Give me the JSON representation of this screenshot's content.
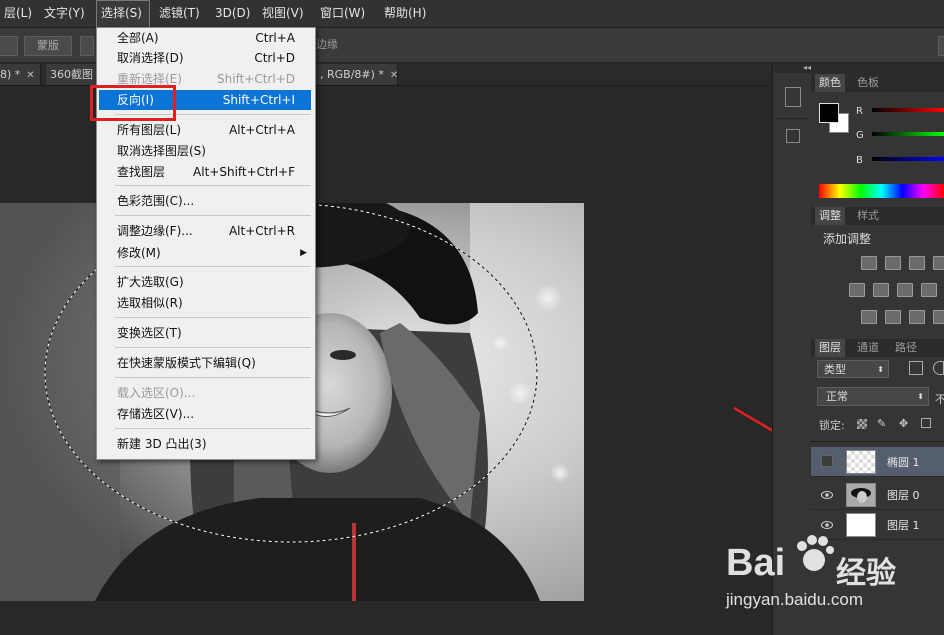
{
  "menubar": {
    "items": [
      "层(L)",
      "文字(Y)",
      "选择(S)",
      "滤镜(T)",
      "3D(D)",
      "视图(V)",
      "窗口(W)",
      "帮助(H)"
    ]
  },
  "optionsbar": {
    "btn_mask": "蒙版",
    "btn_edge": "边缘"
  },
  "tabs": [
    {
      "label": "8) *"
    },
    {
      "label": "360截图"
    },
    {
      "label": ", RGB/8#) *"
    }
  ],
  "select_menu": {
    "items": [
      {
        "label": "全部(A)",
        "shortcut": "Ctrl+A"
      },
      {
        "label": "取消选择(D)",
        "shortcut": "Ctrl+D"
      },
      {
        "label": "重新选择(E)",
        "shortcut": "Shift+Ctrl+D"
      },
      {
        "label": "反向(I)",
        "shortcut": "Shift+Ctrl+I"
      },
      {
        "label": "所有图层(L)",
        "shortcut": "Alt+Ctrl+A"
      },
      {
        "label": "取消选择图层(S)",
        "shortcut": ""
      },
      {
        "label": "查找图层",
        "shortcut": "Alt+Shift+Ctrl+F"
      },
      {
        "label": "色彩范围(C)...",
        "shortcut": ""
      },
      {
        "label": "调整边缘(F)...",
        "shortcut": "Alt+Ctrl+R"
      },
      {
        "label": "修改(M)",
        "shortcut": ""
      },
      {
        "label": "扩大选取(G)",
        "shortcut": ""
      },
      {
        "label": "选取相似(R)",
        "shortcut": ""
      },
      {
        "label": "变换选区(T)",
        "shortcut": ""
      },
      {
        "label": "在快速蒙版模式下编辑(Q)",
        "shortcut": ""
      },
      {
        "label": "载入选区(O)...",
        "shortcut": ""
      },
      {
        "label": "存储选区(V)...",
        "shortcut": ""
      },
      {
        "label": "新建 3D 凸出(3)",
        "shortcut": ""
      }
    ]
  },
  "color_panel": {
    "tabs": [
      "颜色",
      "色板"
    ],
    "channels": [
      "R",
      "G",
      "B"
    ]
  },
  "adjust_panel": {
    "tabs": [
      "调整",
      "样式"
    ],
    "title": "添加调整"
  },
  "layers_panel": {
    "tabs": [
      "图层",
      "通道",
      "路径"
    ],
    "filter": "类型",
    "blend": "正常",
    "opacity_stub": "不",
    "lock_label": "锁定:",
    "layers": [
      {
        "name": "椭圆 1",
        "selected": true,
        "visible": false
      },
      {
        "name": "图层 0",
        "selected": false,
        "visible": true
      },
      {
        "name": "图层 1",
        "selected": false,
        "visible": true
      }
    ]
  },
  "watermark": {
    "brand": "Bai",
    "brand2": "经验",
    "url": "jingyan.baidu.com"
  },
  "colors": {
    "highlight": "#0b74d6",
    "annotation_red": "#e02020"
  }
}
